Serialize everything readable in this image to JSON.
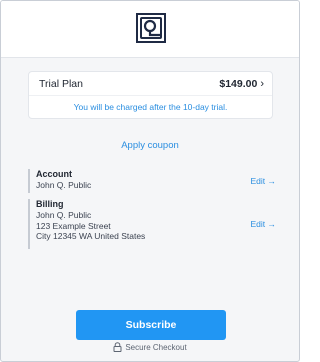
{
  "header": {
    "logo_icon": "brand-logo-icon"
  },
  "plan": {
    "name": "Trial Plan",
    "price": "$149.00",
    "chevron": "›",
    "note": "You will be charged after the 10-day trial."
  },
  "coupon": {
    "label": "Apply coupon"
  },
  "account": {
    "title": "Account",
    "name": "John Q. Public",
    "edit_label": "Edit →"
  },
  "billing": {
    "title": "Billing",
    "name": "John Q. Public",
    "street": "123 Example Street",
    "city_line": "City 12345 WA United States",
    "edit_label": "Edit →"
  },
  "checkout": {
    "subscribe_label": "Subscribe",
    "secure_label": "Secure Checkout"
  },
  "colors": {
    "accent": "#2196f3",
    "link": "#2a8ee0",
    "brand": "#1f2a44"
  }
}
